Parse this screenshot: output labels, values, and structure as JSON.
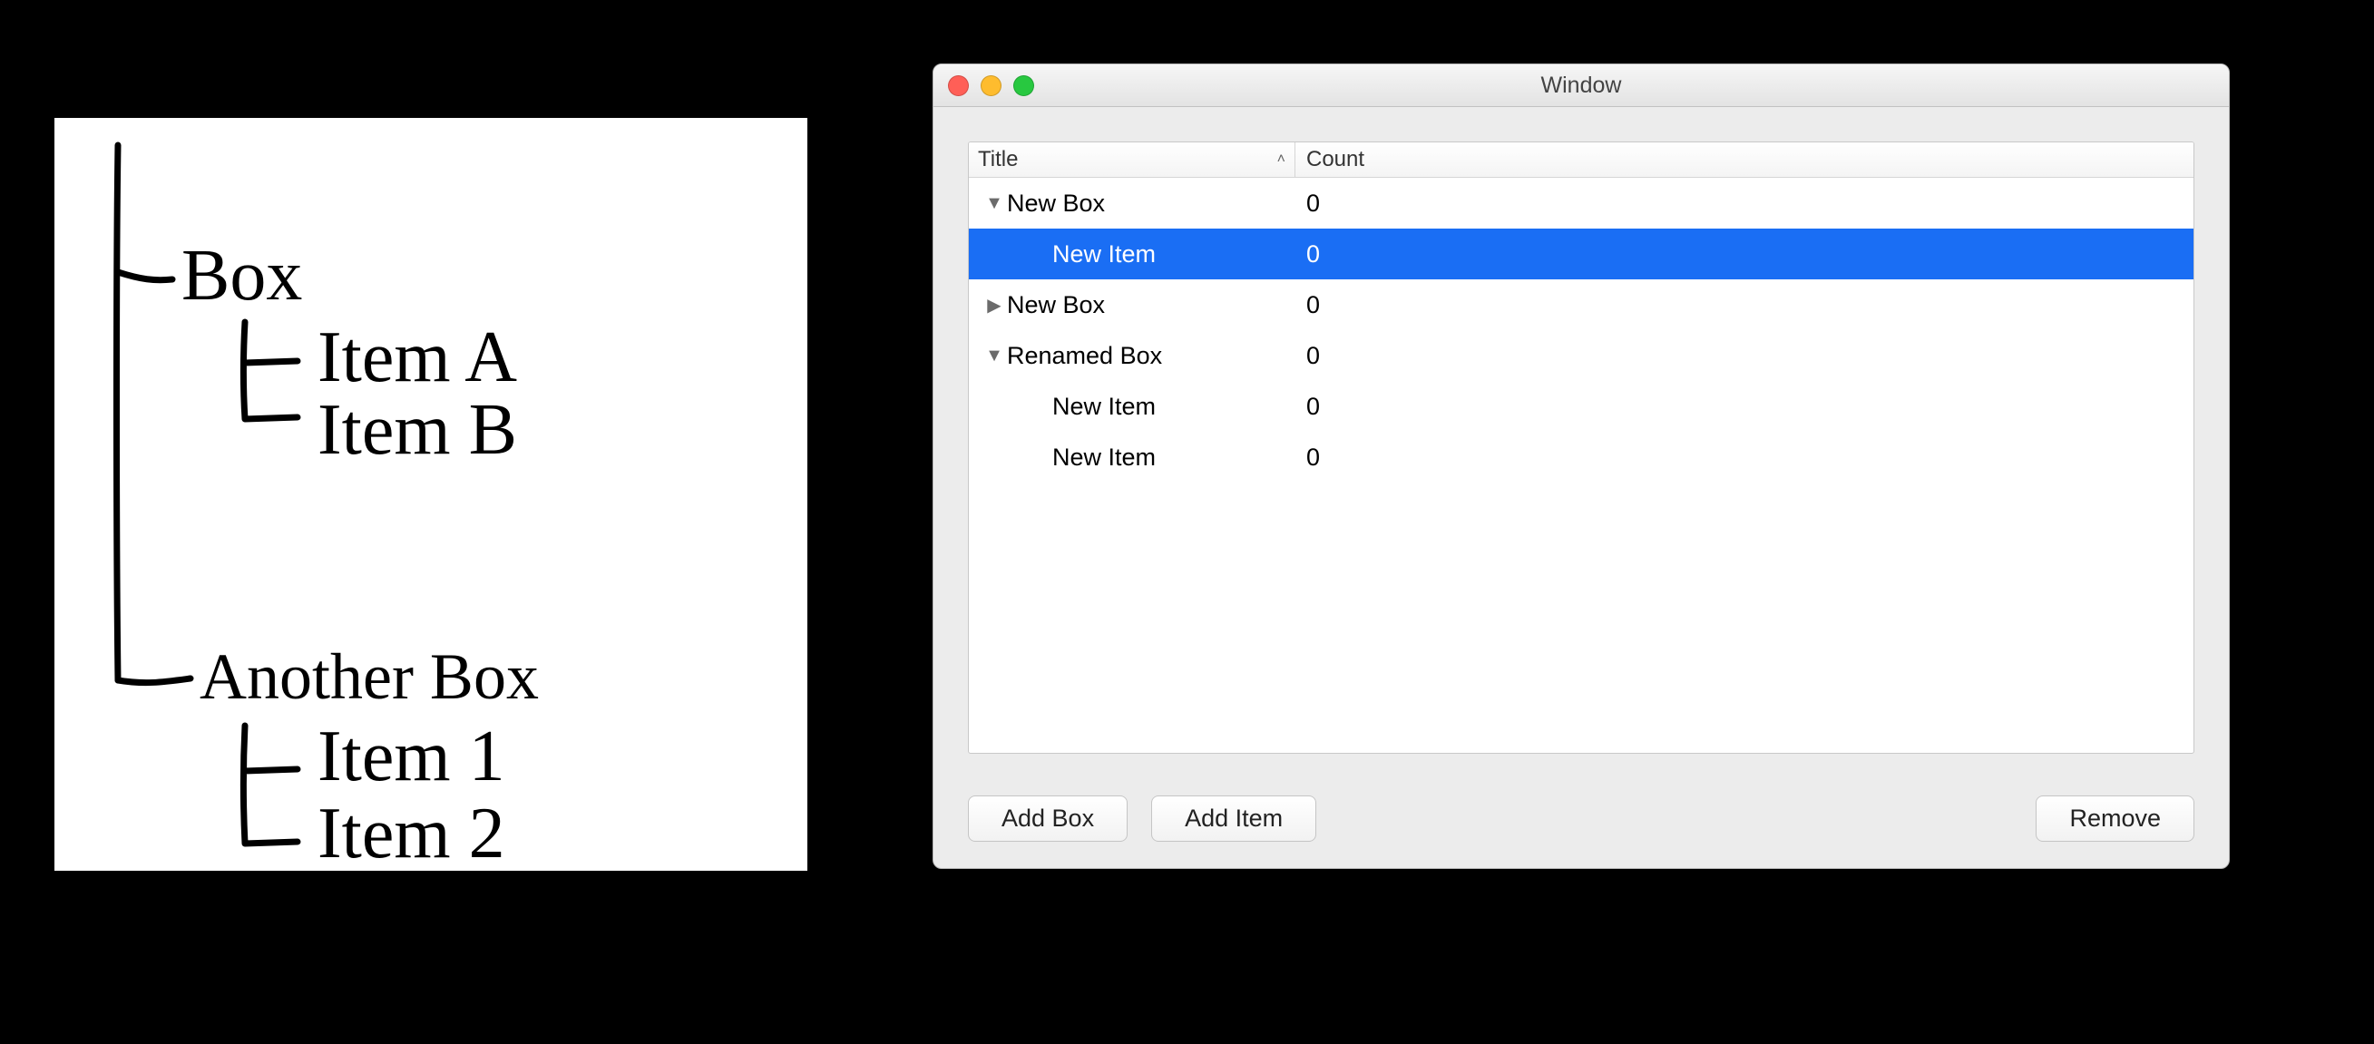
{
  "sketch": {
    "lines": [
      "Box",
      "Item A",
      "Item B",
      "Another Box",
      "Item 1",
      "Item 2"
    ]
  },
  "window": {
    "title": "Window",
    "columns": {
      "title": "Title",
      "count": "Count"
    },
    "rows": [
      {
        "title": "New Box",
        "count": "0",
        "level": 0,
        "disclosure": "down",
        "selected": false
      },
      {
        "title": "New Item",
        "count": "0",
        "level": 1,
        "disclosure": "",
        "selected": true
      },
      {
        "title": "New Box",
        "count": "0",
        "level": 0,
        "disclosure": "right",
        "selected": false
      },
      {
        "title": "Renamed Box",
        "count": "0",
        "level": 0,
        "disclosure": "down",
        "selected": false
      },
      {
        "title": "New Item",
        "count": "0",
        "level": 1,
        "disclosure": "",
        "selected": false
      },
      {
        "title": "New Item",
        "count": "0",
        "level": 1,
        "disclosure": "",
        "selected": false
      }
    ],
    "buttons": {
      "addBox": "Add Box",
      "addItem": "Add Item",
      "remove": "Remove"
    }
  }
}
